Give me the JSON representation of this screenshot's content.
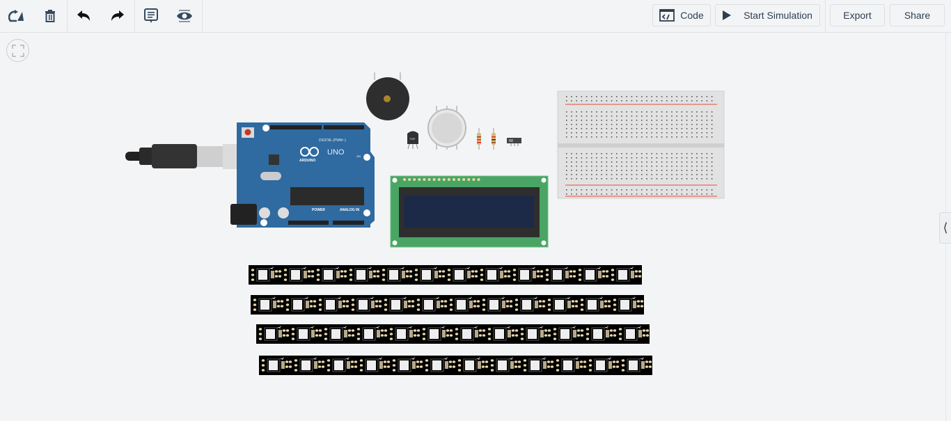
{
  "toolbar": {
    "left_icons": [
      "rotate-icon",
      "trash-icon",
      "undo-icon",
      "redo-icon",
      "notes-icon",
      "visibility-icon"
    ],
    "code_label": "Code",
    "start_simulation_label": "Start Simulation",
    "export_label": "Export",
    "share_label": "Share"
  },
  "canvas": {
    "fit_view_icon": "fit-view-icon",
    "panel_toggle": "⟨",
    "components": {
      "arduino": {
        "brand": "ARDUINO",
        "model": "UNO",
        "digital_label": "DIGITAL (PWM~)",
        "power_label": "POWER",
        "analog_label": "ANALOG IN",
        "on_label": "ON"
      },
      "temp_sensor": {
        "label": "TMP"
      },
      "resistor_count": 2,
      "neopixel_strip_count": 4,
      "neopixels_per_strip": 12
    }
  },
  "colors": {
    "arduino_blue": "#2f6aa0",
    "lcd_green": "#4aa564",
    "lcd_screen": "#1c2a48",
    "strip_black": "#000000"
  }
}
